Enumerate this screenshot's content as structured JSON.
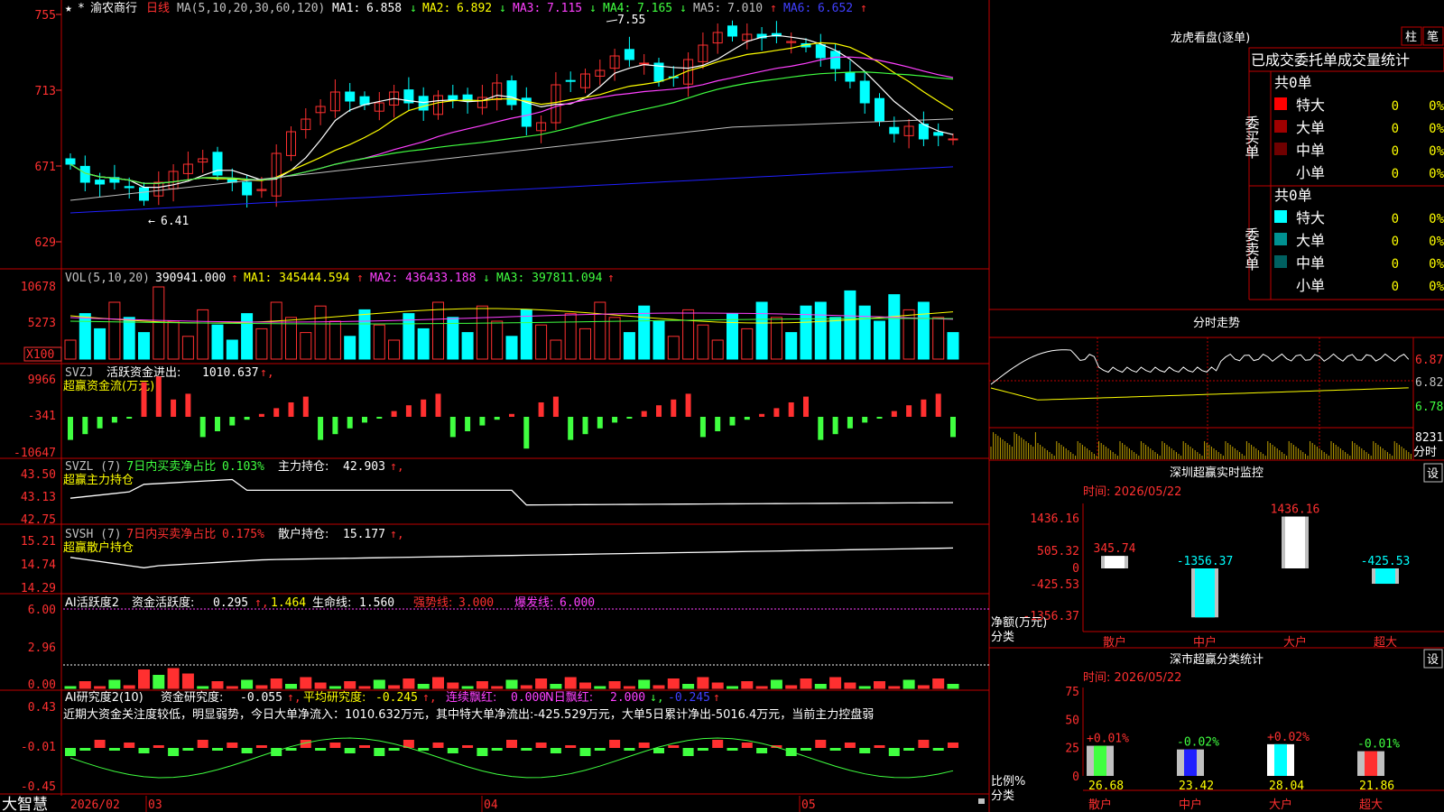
{
  "stock": {
    "name": "渝农商行",
    "period": "日线"
  },
  "colors": {
    "up": "#ff3030",
    "down": "#00ffff",
    "grid": "#c00000",
    "yellow": "#ffff00",
    "magenta": "#ff40ff",
    "green": "#40ff40",
    "blue": "#2020ff",
    "gray": "#c0c0c0",
    "white": "#ffffff"
  },
  "kline_header": {
    "ma_params": "MA(5,10,20,30,60,120)",
    "ma1_label": "MA1:",
    "ma1_value": "6.858",
    "ma2_label": "MA2:",
    "ma2_value": "6.892",
    "ma3_label": "MA3:",
    "ma3_value": "7.115",
    "ma4_label": "MA4:",
    "ma4_value": "7.165",
    "ma5_label": "MA5:",
    "ma5_value": "7.010",
    "ma6_label": "MA6:",
    "ma6_value": "6.652",
    "y_ticks": [
      "755",
      "713",
      "671",
      "629"
    ],
    "high_label": "7.55",
    "low_label": "6.41"
  },
  "vol_header": {
    "params": "VOL(5,10,20)",
    "value": "390941.000",
    "ma1": "MA1: 345444.594",
    "ma2": "MA2: 436433.188",
    "ma3": "MA3: 397811.094",
    "y_ticks": [
      "10678",
      "5273"
    ],
    "unit": "X100"
  },
  "svzj_header": {
    "name": "SVZJ",
    "label": "活跃资金进出:",
    "value": "1010.637",
    "subtitle": "超赢资金流(万元)",
    "y_ticks": [
      "9966",
      "-341",
      "-10647"
    ]
  },
  "svzl_header": {
    "name": "SVZL (7)",
    "label": "7日内买卖净占比",
    "value": "0.103%",
    "label2": "主力持仓:",
    "value2": "42.903",
    "subtitle": "超赢主力持仓",
    "y_ticks": [
      "43.50",
      "43.13",
      "42.75"
    ]
  },
  "svsh_header": {
    "name": "SVSH (7)",
    "label": "7日内买卖净占比",
    "value": "0.175%",
    "label2": "散户持仓:",
    "value2": "15.177",
    "subtitle": "超赢散户持仓",
    "y_ticks": [
      "15.21",
      "14.74",
      "14.29"
    ]
  },
  "ai_active": {
    "name": "AI活跃度2",
    "label": "资金活跃度:",
    "v1": "0.295",
    "v2": "1.464",
    "label3": "生命线:",
    "v3": "1.560",
    "label4": "强势线:",
    "v4": "3.000",
    "label5": "爆发线:",
    "v5": "6.000",
    "y_ticks": [
      "6.00",
      "2.96",
      "0.00"
    ]
  },
  "ai_research": {
    "name": "AI研究度2(10)",
    "label": "资金研究度:",
    "v1": "-0.055",
    "label2": "平均研究度:",
    "v2": "-0.245",
    "label3": "连续飘红:",
    "v3": "0.000",
    "label4": "N日飘红:",
    "v4": "2.000",
    "v5": "-0.245",
    "note": "近期大资金关注度较低，明显弱势，今日大单净流入：1010.632万元，其中特大单净流出:-425.529万元，大单5日累计净出-5016.4万元，当前主力控盘弱",
    "y_ticks": [
      "0.43",
      "-0.01",
      "-0.45"
    ]
  },
  "footer": {
    "brand": "大智慧",
    "d1": "2026/02",
    "m3": "03",
    "m4": "04",
    "m5": "05"
  },
  "lhb": {
    "title": "龙虎看盘(逐单)",
    "btn1": "柱",
    "btn2": "笔",
    "sub": "已成交委托单成交量统计",
    "buy": {
      "side": "委买单",
      "total": "共0单",
      "rows": [
        {
          "name": "特大",
          "count": "0",
          "pct": "0%",
          "color": "#ff0000"
        },
        {
          "name": "大单",
          "count": "0",
          "pct": "0%",
          "color": "#a00000"
        },
        {
          "name": "中单",
          "count": "0",
          "pct": "0%",
          "color": "#700000"
        },
        {
          "name": "小单",
          "count": "0",
          "pct": "0%",
          "color": ""
        }
      ]
    },
    "sell": {
      "side": "委卖单",
      "total": "共0单",
      "rows": [
        {
          "name": "特大",
          "count": "0",
          "pct": "0%",
          "color": "#00ffff"
        },
        {
          "name": "大单",
          "count": "0",
          "pct": "0%",
          "color": "#009090"
        },
        {
          "name": "中单",
          "count": "0",
          "pct": "0%",
          "color": "#006060"
        },
        {
          "name": "小单",
          "count": "0",
          "pct": "0%",
          "color": ""
        }
      ]
    }
  },
  "intraday": {
    "title": "分时走势",
    "y_ticks": [
      "6.87",
      "6.82",
      "6.78"
    ],
    "vol_label": "8231",
    "unit": "分时"
  },
  "sz_monitor": {
    "title": "深圳超赢实时监控",
    "btn": "设",
    "time": "时间: 2026/05/22",
    "y_ticks": [
      "1436.16",
      "505.32",
      "0",
      "-425.53",
      "-1356.37"
    ],
    "ylabel": "净额(万元)",
    "xlabel": "分类",
    "chart_data": {
      "type": "bar",
      "categories": [
        "散户",
        "中户",
        "大户",
        "超大"
      ],
      "values": [
        345.74,
        -1356.37,
        1436.16,
        -425.53
      ],
      "value_labels": [
        "345.74",
        "-1356.37",
        "1436.16",
        "-425.53"
      ],
      "ylim": [
        -1356.37,
        1436.16
      ]
    }
  },
  "sz_class": {
    "title": "深市超赢分类统计",
    "btn": "设",
    "time": "时间: 2026/05/22",
    "y_ticks": [
      "75",
      "50",
      "25",
      "0"
    ],
    "ylabel": "比例%",
    "xlabel": "分类",
    "chart_data": {
      "type": "bar",
      "categories": [
        "散户",
        "中户",
        "大户",
        "超大"
      ],
      "values": [
        26.68,
        23.42,
        28.04,
        21.86
      ],
      "change_labels": [
        "+0.01%",
        "-0.02%",
        "+0.02%",
        "-0.01%"
      ],
      "value_labels": [
        "26.68",
        "23.42",
        "28.04",
        "21.86"
      ],
      "ylim": [
        0,
        75
      ]
    }
  }
}
